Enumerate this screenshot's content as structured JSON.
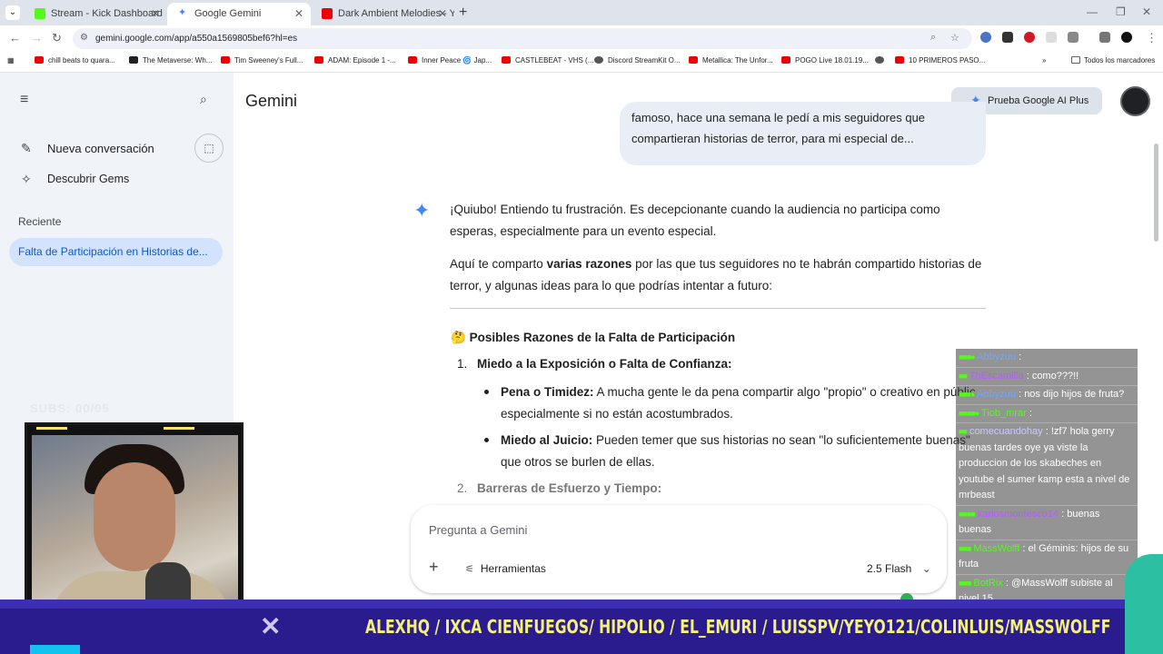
{
  "browser": {
    "tabs": [
      {
        "title": "Stream - Kick Dashboard",
        "favicon_color": "#53fc18"
      },
      {
        "title": "Google Gemini",
        "favicon_color": "#4285f4"
      },
      {
        "title": "Dark Ambient Melodies - Yo",
        "favicon_color": "#e00"
      }
    ],
    "url": "gemini.google.com/app/a550a1569805bef6?hl=es",
    "bookmarks": [
      "chill beats to quara...",
      "The Metaverse: Wh...",
      "Tim Sweeney's Full...",
      "ADAM: Episode 1 -...",
      "Inner Peace 🌀 Jap...",
      "CASTLEBEAT - VHS (...",
      "Discord StreamKit O...",
      "Metallica: The Unfor...",
      "POGO Live 18.01.19...",
      "10 PRIMEROS PASO..."
    ],
    "all_bookmarks": "Todos los marcadores"
  },
  "sidebar": {
    "new_chat": "Nueva conversación",
    "gems": "Descubrir Gems",
    "recent_header": "Reciente",
    "recent_item": "Falta de Participación en Historias de...",
    "overlay_subs": "SUBS: 00/05"
  },
  "header": {
    "title": "Gemini",
    "ai_plus": "Prueba Google AI Plus"
  },
  "conversation": {
    "user_bubble_line1": "famoso, hace una semana le pedí a mis seguidores que",
    "user_bubble_line2": "compartieran historias de terror, para mi especial de...",
    "reply_p1_line1": "¡Quiubo! Entiendo tu frustración. Es decepcionante cuando la audiencia no participa como",
    "reply_p1_line2": "esperas, especialmente para un evento especial.",
    "reply_p2_pre": "Aquí te comparto ",
    "reply_p2_bold": "varias razones",
    "reply_p2_post": " por las que tus seguidores no te habrán compartido historias de",
    "reply_p2_line2": "terror, y algunas ideas para lo que podrías intentar a futuro:",
    "section_icon": "🤔",
    "section_title": "Posibles Razones de la Falta de Participación",
    "item1_num": "1.",
    "item1_title": "Miedo a la Exposición o Falta de Confianza:",
    "b1_bold": "Pena o Timidez:",
    "b1_text": " A mucha gente le da pena compartir algo \"propio\" o creativo en públic",
    "b1_line2": "especialmente si no están acostumbrados.",
    "b2_bold": "Miedo al Juicio:",
    "b2_text": " Pueden temer que sus historias no sean \"lo suficientemente buenas\"",
    "b2_line2": "que otros se burlen de ellas.",
    "item2_num": "2.",
    "item2_title": "Barreras de Esfuerzo y Tiempo:"
  },
  "prompt": {
    "placeholder": "Pregunta a Gemini",
    "tools": "Herramientas",
    "model": "2.5 Flash"
  },
  "chat": [
    {
      "user": "Abbyzuu",
      "color": "#6fa8ff",
      "text": ":"
    },
    {
      "user": "ThEscamilla",
      "color": "#b45cff",
      "text": ": como???!!"
    },
    {
      "user": "Abbyzuu",
      "color": "#6fa8ff",
      "text": ": nos dijo hijos de fruta?"
    },
    {
      "user": "Tiob_mrar",
      "color": "#53fc18",
      "text": ":"
    },
    {
      "user": "comecuandohay",
      "color": "#c9c9ff",
      "text": ": !zf7 hola gerry buenas tardes oye ya viste la produccion de los skabeches en youtube el sumer kamp esta a nivel de mrbeast"
    },
    {
      "user": "karlosmontesco14",
      "color": "#b45cff",
      "text": ": buenas buenas"
    },
    {
      "user": "MassWolff",
      "color": "#53fc18",
      "text": ": el Géminis: hijos de su fruta"
    },
    {
      "user": "BotRix",
      "color": "#53fc18",
      "text": ": @MassWolff subiste al nivel 15"
    }
  ],
  "banner": {
    "names": "ALEXHQ / IXCA CIENFUEGOS/ HIPOLIO / EL_EMURI / LUISSPV/YEYO121/COLINLUIS/MASSWOLFF"
  },
  "colors": {
    "sidebar_bg": "#f0f4f9",
    "accent": "#4285f4",
    "banner_bg": "#2a1c8f",
    "banner_text": "#f4f07a"
  }
}
